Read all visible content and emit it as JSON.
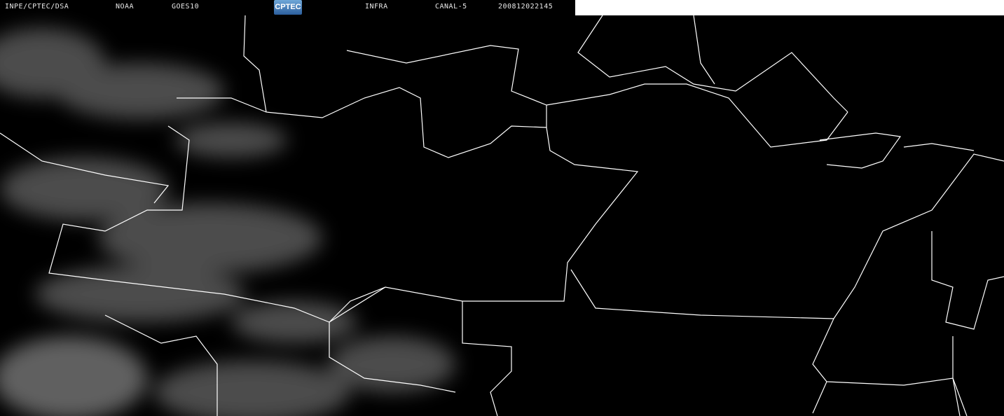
{
  "header": {
    "source": "INPE/CPTEC/DSA",
    "agency": "NOAA",
    "satellite": "GOES10",
    "logo_text": "CPTEC",
    "band": "INFRA",
    "channel": "CANAL-5",
    "datetime": "200812022145"
  },
  "colors": {
    "background": "#000000",
    "borders": "#ffffff",
    "clouds": "#9a9a9a"
  }
}
